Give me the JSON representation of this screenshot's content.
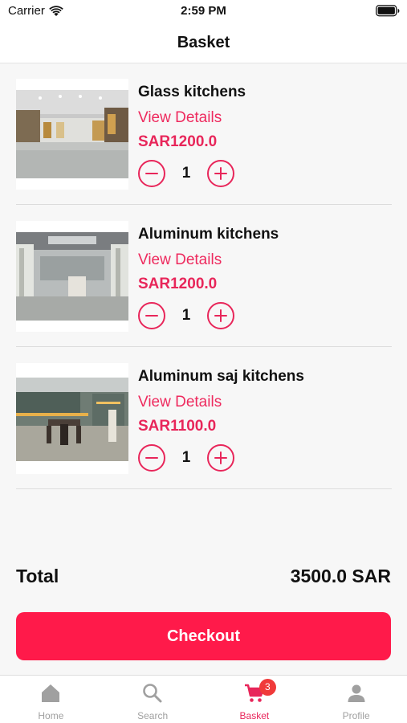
{
  "status": {
    "carrier": "Carrier",
    "time": "2:59 PM"
  },
  "header": {
    "title": "Basket"
  },
  "items": [
    {
      "name": "Glass kitchens",
      "details_label": "View Details",
      "price": "SAR1200.0",
      "quantity": "1"
    },
    {
      "name": "Aluminum kitchens",
      "details_label": "View Details",
      "price": "SAR1200.0",
      "quantity": "1"
    },
    {
      "name": "Aluminum saj kitchens",
      "details_label": "View Details",
      "price": "SAR1100.0",
      "quantity": "1"
    }
  ],
  "summary": {
    "total_label": "Total",
    "total_value": "3500.0 SAR"
  },
  "checkout": {
    "label": "Checkout"
  },
  "tabs": [
    {
      "label": "Home",
      "icon": "home-icon"
    },
    {
      "label": "Search",
      "icon": "search-icon"
    },
    {
      "label": "Basket",
      "icon": "cart-icon",
      "badge": "3",
      "active": true
    },
    {
      "label": "Profile",
      "icon": "person-icon"
    }
  ],
  "colors": {
    "accent": "#e8265a",
    "checkout": "#ff1a4a",
    "badge": "#f03a3a",
    "inactive_tab": "#a0a0a0"
  }
}
